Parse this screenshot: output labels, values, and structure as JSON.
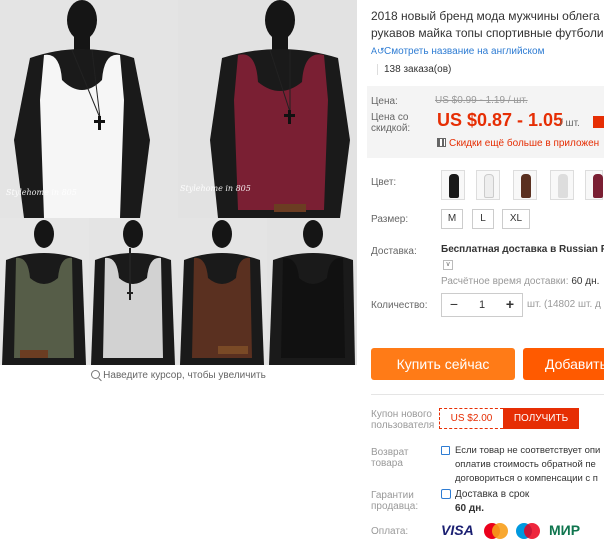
{
  "gallery": {
    "watermark_1": "Stylehome in 805",
    "watermark_2": "Stylehome in 805",
    "zoom_hint": "Наведите курсор, чтобы увеличить"
  },
  "product": {
    "title_line1": "2018 новый бренд мода мужчины облега",
    "title_line2": "рукавов майка топы спортивные футболи",
    "translate_link": "Смотреть название на английском",
    "orders": "138 заказа(ов)"
  },
  "price": {
    "label": "Цена:",
    "old": "US $0.99 - 1.19 / шт.",
    "discount_label_1": "Цена со",
    "discount_label_2": "скидкой:",
    "new": "US $0.87 - 1.05",
    "unit": "/ шт.",
    "app_deal": "Скидки ещё больше в приложен"
  },
  "color": {
    "label": "Цвет:",
    "swatches": [
      {
        "name": "black",
        "hex": "#1a1a1a"
      },
      {
        "name": "white",
        "hex": "#eeeeee"
      },
      {
        "name": "brown",
        "hex": "#5a3020"
      },
      {
        "name": "gray-white",
        "hex": "#dddddd"
      },
      {
        "name": "wine",
        "hex": "#7a1f33"
      }
    ]
  },
  "size": {
    "label": "Размер:",
    "options": [
      "M",
      "L",
      "XL"
    ]
  },
  "shipping": {
    "label": "Доставка:",
    "value": "Бесплатная доставка в Russian Fe",
    "eta_label": "Расчётное время доставки:",
    "eta_value": "60 дн."
  },
  "quantity": {
    "label": "Количество:",
    "value": "1",
    "minus": "−",
    "plus": "+",
    "stock": "шт. (14802 шт. д"
  },
  "actions": {
    "buy_now": "Купить сейчас",
    "add_to_cart": "Добавить"
  },
  "coupon": {
    "label_1": "Купон нового",
    "label_2": "пользователя",
    "value": "US $2.00",
    "button": "ПОЛУЧИТЬ"
  },
  "returns": {
    "label_1": "Возврат",
    "label_2": "товара",
    "line1": "Если товар не соответствует опи",
    "line2": "оплатив стоимость обратной пе",
    "line3": "договориться о компенсации с п"
  },
  "guarantee": {
    "label_1": "Гарантии",
    "label_2": "продавца:",
    "line1": "Доставка в срок",
    "line2": "60 дн."
  },
  "payment": {
    "label": "Оплата:",
    "visa": "VISA",
    "mir": "МИР",
    "colors": {
      "visa": "#1a1f71",
      "mc_red": "#eb001b",
      "mc_yellow": "#f79e1b",
      "maestro_blue": "#0099df",
      "mir": "#0f754e"
    }
  }
}
